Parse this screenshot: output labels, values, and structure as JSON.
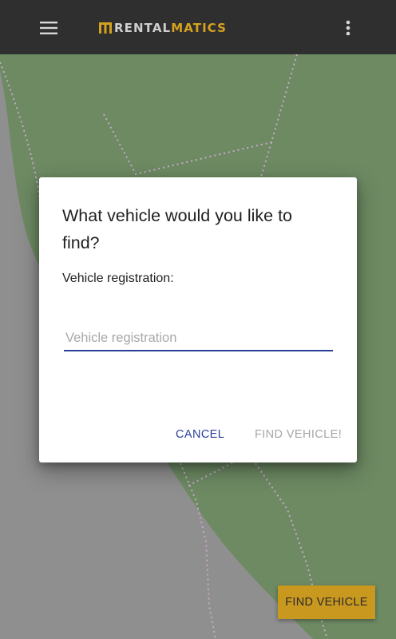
{
  "appbar": {
    "logo_part1": "RENTAL",
    "logo_part2": "MATICS",
    "menu_icon": "hamburger-menu-icon",
    "overflow_icon": "more-vert-icon"
  },
  "dialog": {
    "title": "What vehicle would you like to find?",
    "field_label": "Vehicle registration:",
    "input_placeholder": "Vehicle registration",
    "input_value": "",
    "cancel_label": "CANCEL",
    "find_label": "FIND VEHICLE!"
  },
  "fab": {
    "label": "FIND VEHICLE"
  },
  "colors": {
    "appbar_bg": "#2f2f2f",
    "accent": "#c9981f",
    "primary": "#2b3f9a",
    "map_green": "#6d8a63",
    "map_gray": "#8f8f8f"
  }
}
